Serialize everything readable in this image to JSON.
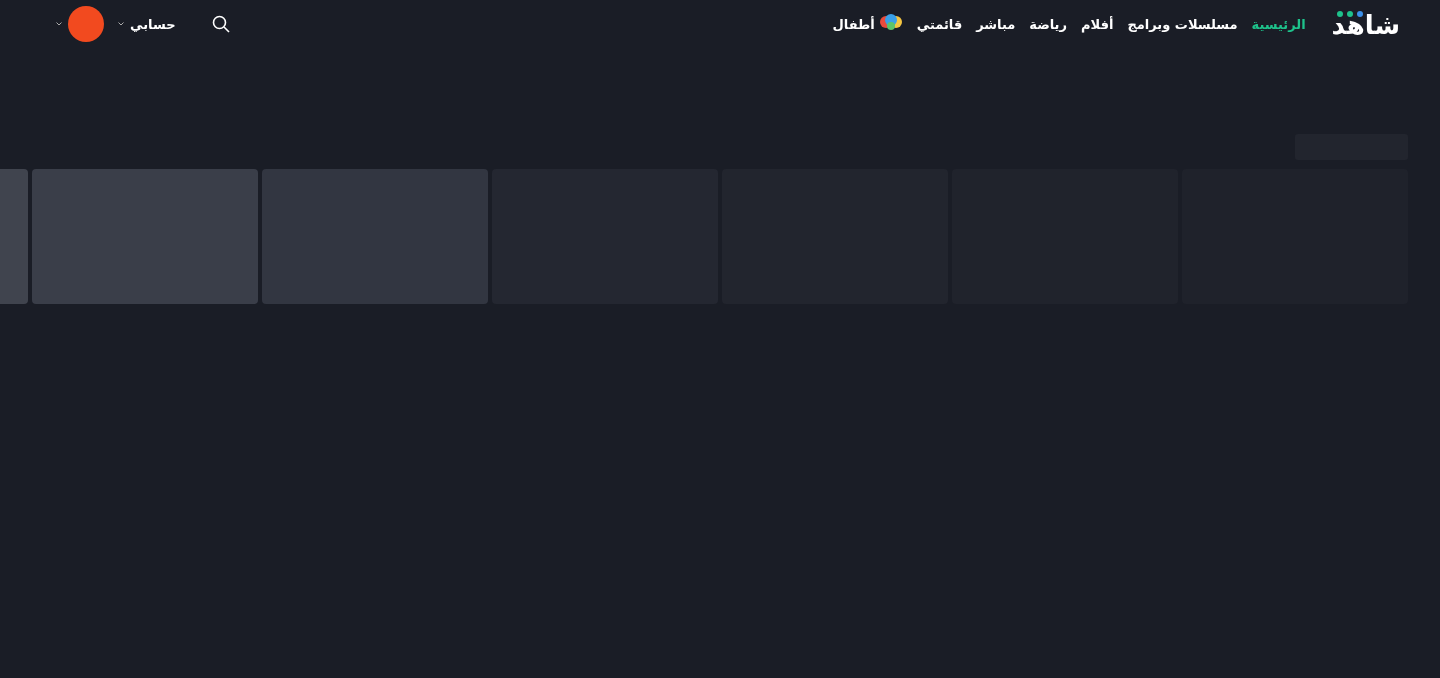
{
  "header": {
    "logo": "شاهد",
    "nav": [
      {
        "label": "الرئيسية",
        "selected": true
      },
      {
        "label": "مسلسلات وبرامج",
        "selected": false
      },
      {
        "label": "أفلام",
        "selected": false
      },
      {
        "label": "رياضة",
        "selected": false
      },
      {
        "label": "مباشر",
        "selected": false
      },
      {
        "label": "قائمتي",
        "selected": false
      },
      {
        "label": "أطفال",
        "selected": false,
        "kind": "kids"
      }
    ],
    "account": "حسابي"
  }
}
